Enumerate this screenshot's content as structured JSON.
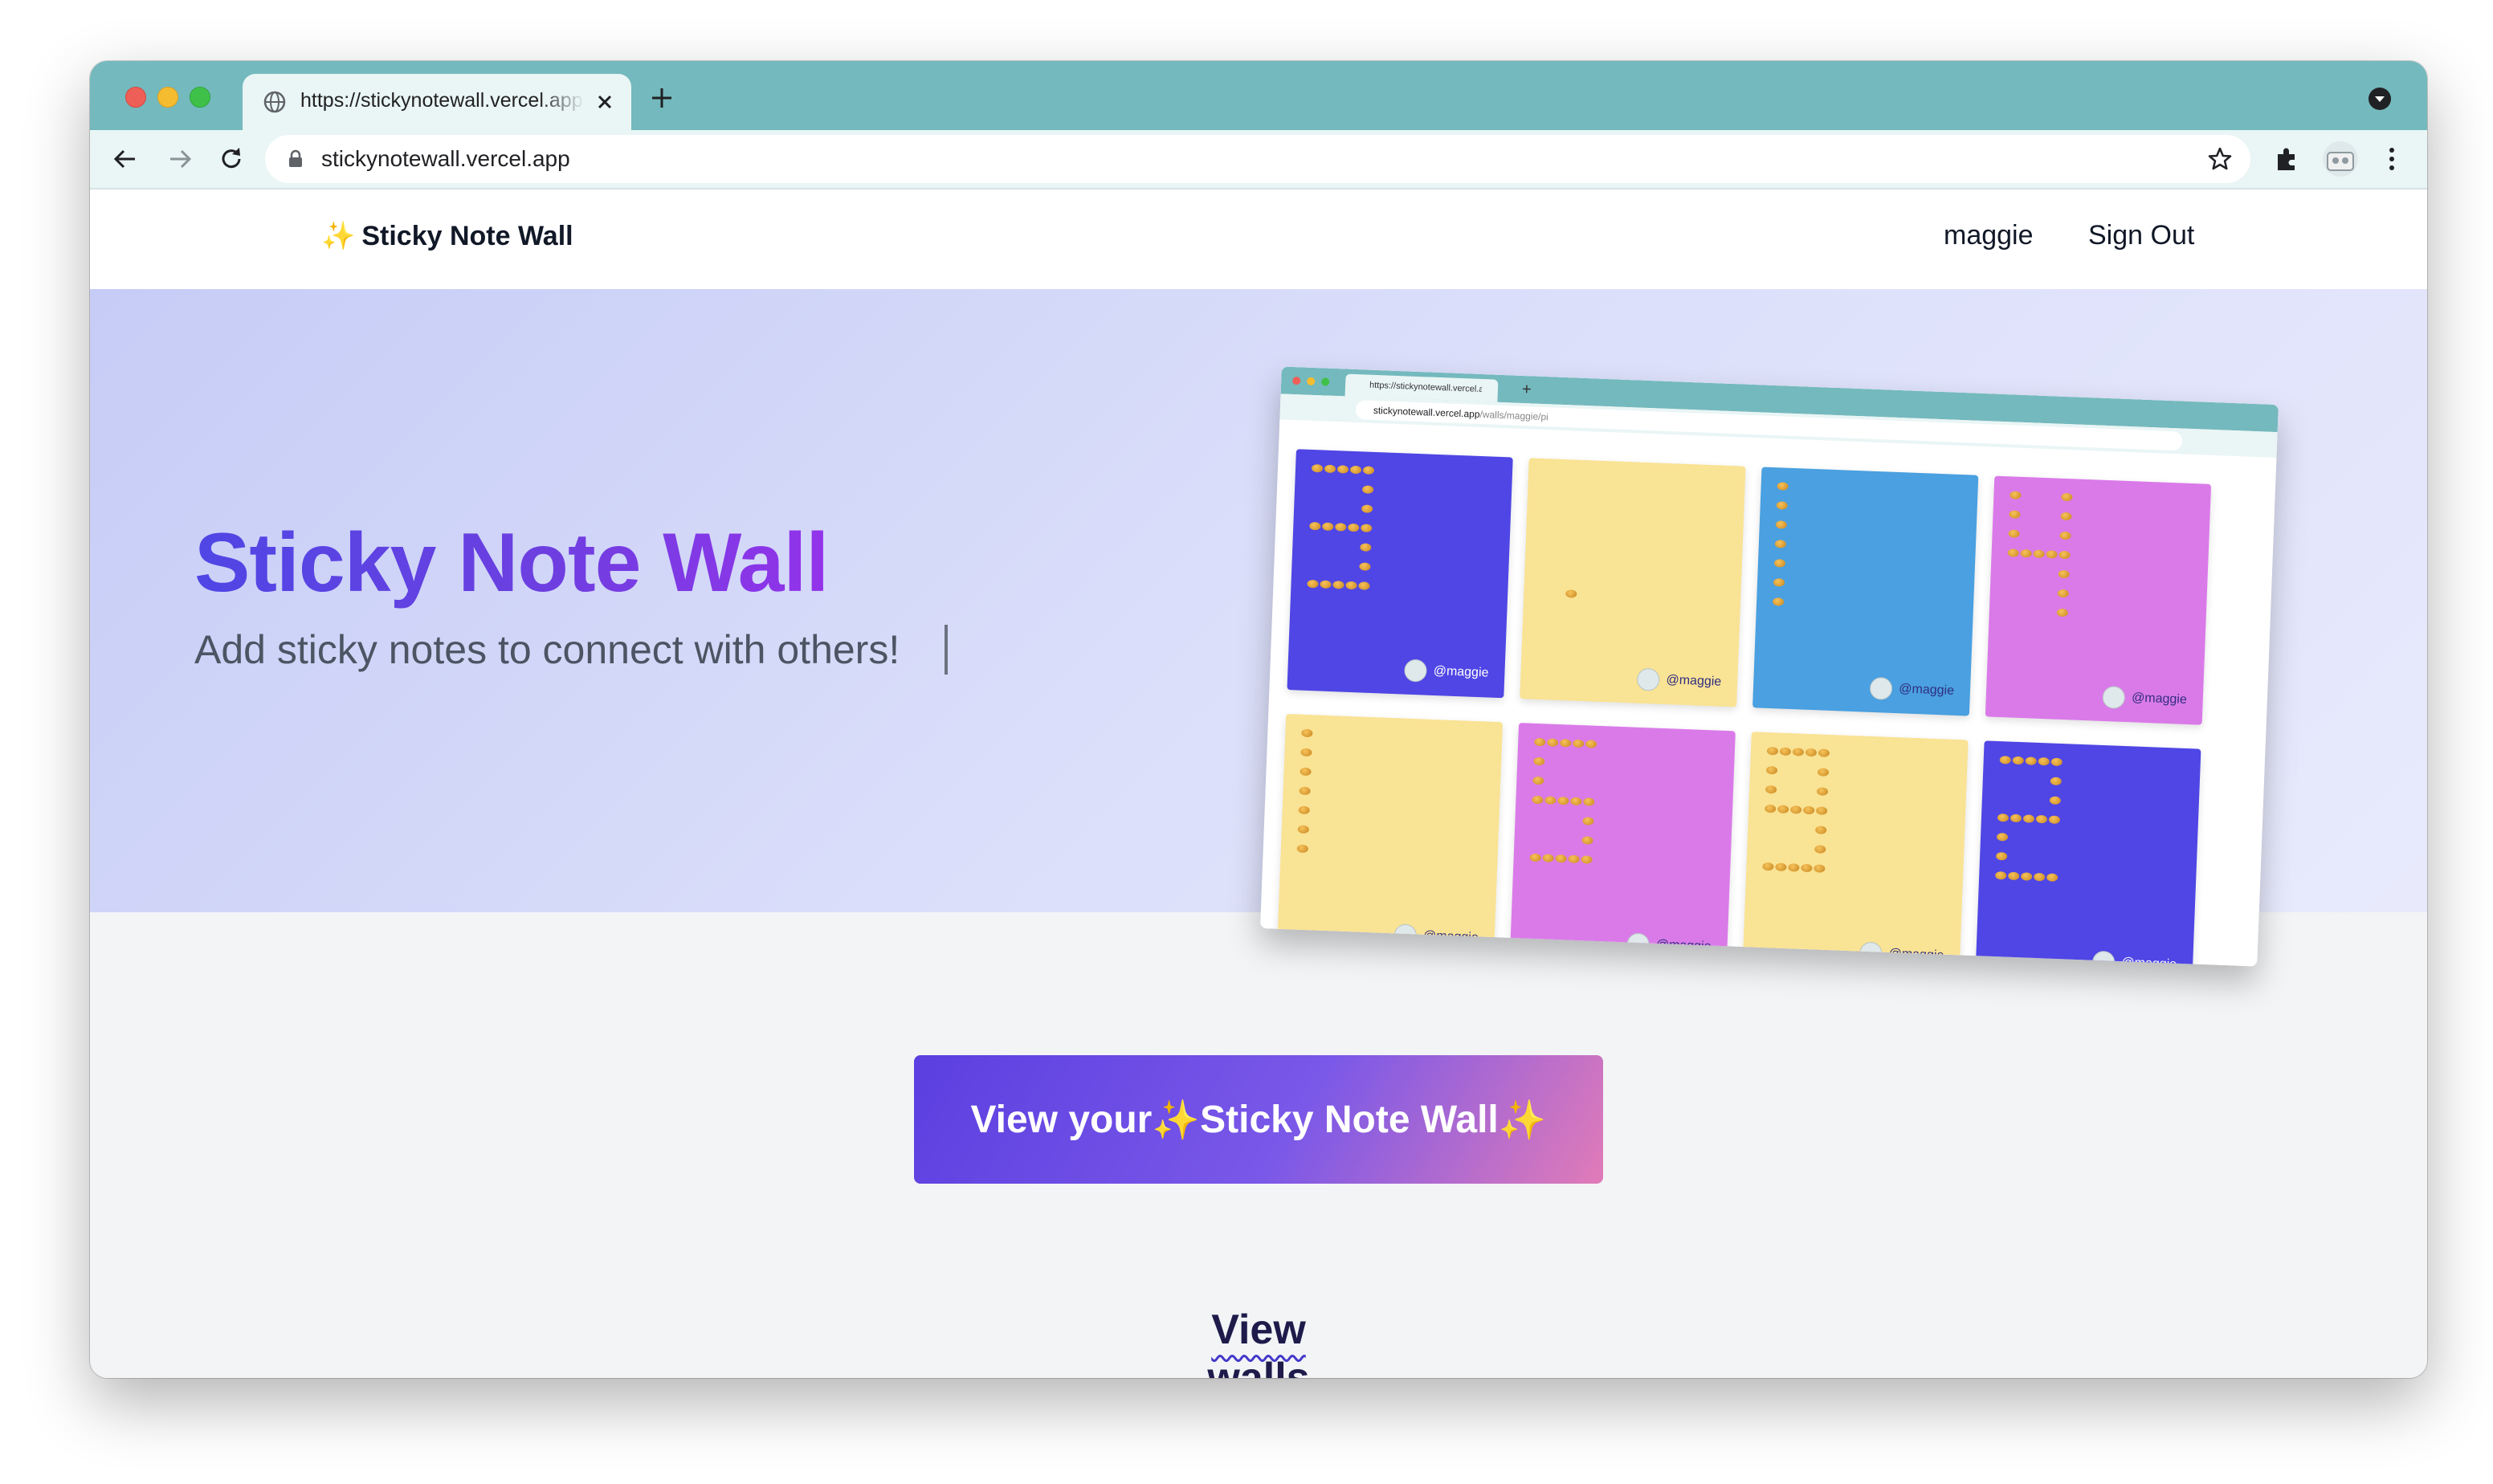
{
  "browser": {
    "tab_title": "https://stickynotewall.vercel.app",
    "url": "stickynotewall.vercel.app"
  },
  "site": {
    "brand_icon": "✨",
    "brand": "Sticky Note Wall",
    "user": "maggie",
    "sign_out": "Sign Out"
  },
  "hero": {
    "title": "Sticky Note Wall",
    "subtitle": "Add sticky notes to connect with others!"
  },
  "preview": {
    "tab_title": "https://stickynotewall.vercel.app",
    "url_host": "stickynotewall.vercel.app",
    "url_path": "/walls/maggie/pi",
    "notes": [
      {
        "color": "#4f46e5",
        "digit": "3",
        "author": "@maggie",
        "author_color": "#ffffff"
      },
      {
        "color": "#f9e394",
        "digit": ".",
        "author": "@maggie",
        "author_color": "#312e81"
      },
      {
        "color": "#4aa0e0",
        "digit": "1",
        "author": "@maggie",
        "author_color": "#312e81"
      },
      {
        "color": "#da7ae9",
        "digit": "4",
        "author": "@maggie",
        "author_color": "#312e81"
      },
      {
        "color": "#f9e394",
        "digit": "1",
        "author": "@maggie",
        "author_color": "#312e81"
      },
      {
        "color": "#da7ae9",
        "digit": "5",
        "author": "@maggie",
        "author_color": "#312e81"
      },
      {
        "color": "#f9e394",
        "digit": "9",
        "author": "@maggie",
        "author_color": "#312e81"
      },
      {
        "color": "#4f46e5",
        "digit": "2",
        "author": "@maggie",
        "author_color": "#ffffff"
      }
    ]
  },
  "cta": {
    "prefix": "View your ",
    "spark": "✨",
    "label": "Sticky Note Wall",
    "spark_end": "✨"
  },
  "walls_section": {
    "title": "View walls"
  },
  "colors": {
    "chrome_teal": "#74b9bd",
    "accent_indigo": "#4f46e5",
    "accent_purple": "#9333ea"
  }
}
